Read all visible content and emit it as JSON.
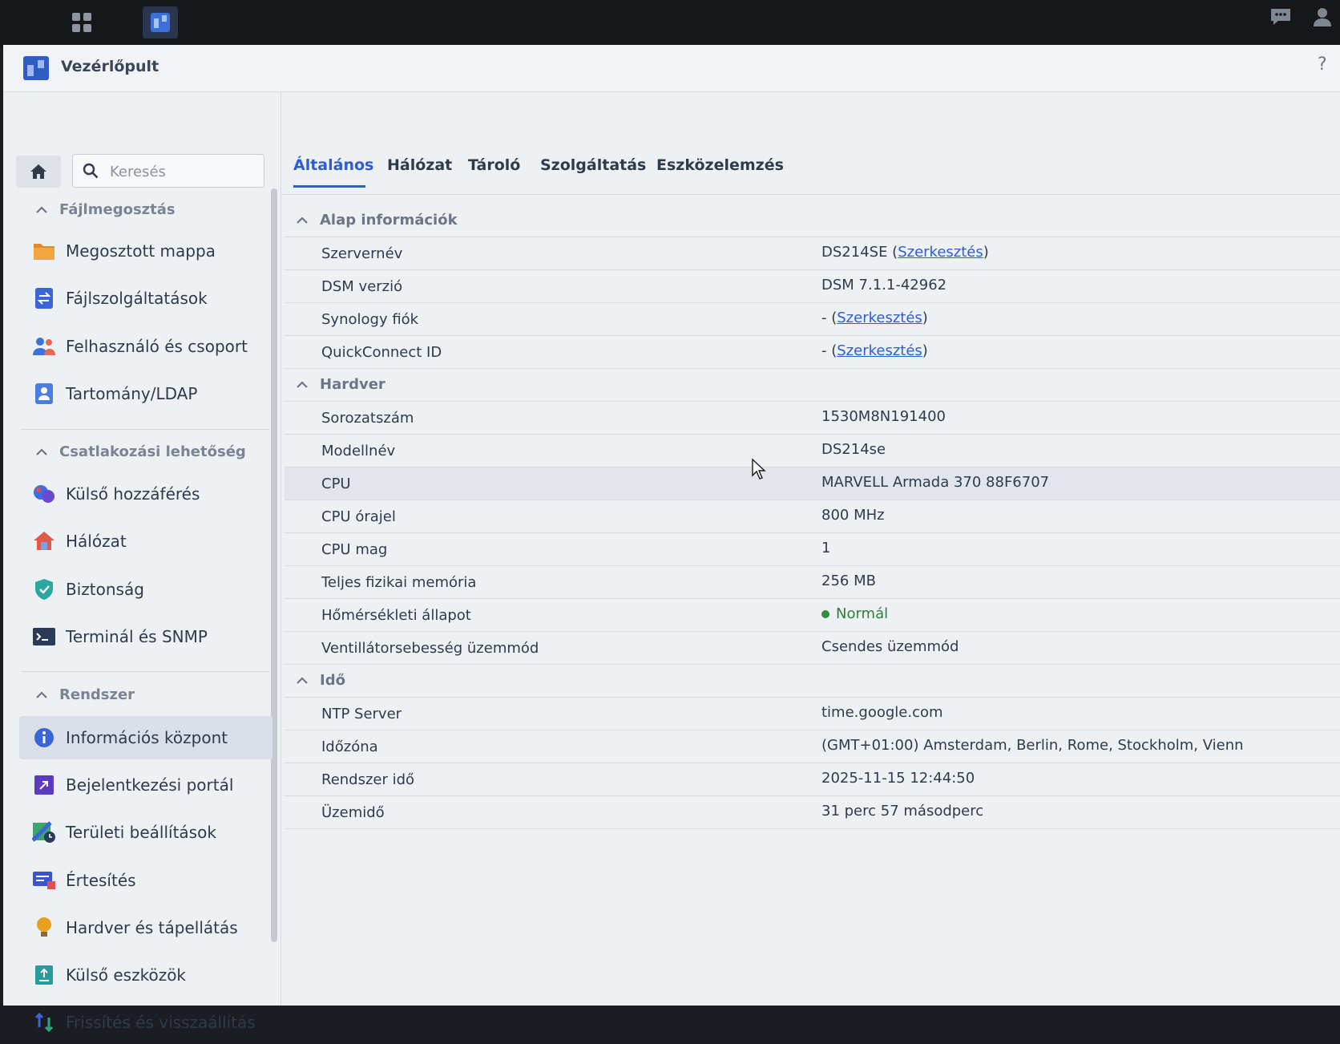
{
  "window": {
    "title": "Vezérlőpult",
    "help": "?"
  },
  "search": {
    "placeholder": "Keresés"
  },
  "sidebar": {
    "sections": [
      {
        "title": "Fájlmegosztás",
        "items": [
          {
            "label": "Megosztott mappa",
            "icon": "folder-icon"
          },
          {
            "label": "Fájlszolgáltatások",
            "icon": "file-services-icon"
          },
          {
            "label": "Felhasználó és csoport",
            "icon": "users-icon"
          },
          {
            "label": "Tartomány/LDAP",
            "icon": "ldap-icon"
          }
        ]
      },
      {
        "title": "Csatlakozási lehetőség",
        "items": [
          {
            "label": "Külső hozzáférés",
            "icon": "external-access-icon"
          },
          {
            "label": "Hálózat",
            "icon": "network-icon"
          },
          {
            "label": "Biztonság",
            "icon": "shield-icon"
          },
          {
            "label": "Terminál és SNMP",
            "icon": "terminal-icon"
          }
        ]
      },
      {
        "title": "Rendszer",
        "items": [
          {
            "label": "Információs központ",
            "icon": "info-icon",
            "active": true
          },
          {
            "label": "Bejelentkezési portál",
            "icon": "login-portal-icon"
          },
          {
            "label": "Területi beállítások",
            "icon": "regional-icon"
          },
          {
            "label": "Értesítés",
            "icon": "notification-icon"
          },
          {
            "label": "Hardver és tápellátás",
            "icon": "bulb-icon"
          },
          {
            "label": "Külső eszközök",
            "icon": "external-device-icon"
          },
          {
            "label": "Frissítés és visszaállítás",
            "icon": "update-icon"
          }
        ]
      }
    ]
  },
  "tabs": [
    "Általános",
    "Hálózat",
    "Tároló",
    "Szolgáltatás",
    "Eszközelemzés"
  ],
  "info": {
    "groups": [
      {
        "title": "Alap információk",
        "rows": [
          {
            "label": "Szervernév",
            "value": "DS214SE",
            "link": "Szerkesztés"
          },
          {
            "label": "DSM verzió",
            "value": "DSM 7.1.1-42962"
          },
          {
            "label": "Synology fiók",
            "value": "-",
            "link": "Szerkesztés"
          },
          {
            "label": "QuickConnect ID",
            "value": "-",
            "link": "Szerkesztés"
          }
        ]
      },
      {
        "title": "Hardver",
        "rows": [
          {
            "label": "Sorozatszám",
            "value": "1530M8N191400"
          },
          {
            "label": "Modellnév",
            "value": "DS214se"
          },
          {
            "label": "CPU",
            "value": "MARVELL Armada 370 88F6707"
          },
          {
            "label": "CPU órajel",
            "value": "800 MHz"
          },
          {
            "label": "CPU mag",
            "value": "1"
          },
          {
            "label": "Teljes fizikai memória",
            "value": "256 MB"
          },
          {
            "label": "Hőmérsékleti állapot",
            "value": "Normál",
            "status_color": "#2f8f3a"
          },
          {
            "label": "Ventillátorsebesség üzemmód",
            "value": "Csendes üzemmód"
          }
        ]
      },
      {
        "title": "Idő",
        "rows": [
          {
            "label": "NTP Server",
            "value": "time.google.com"
          },
          {
            "label": "Időzóna",
            "value": "(GMT+01:00) Amsterdam, Berlin, Rome, Stockholm, Vienn"
          },
          {
            "label": "Rendszer idő",
            "value": "2025-11-15 12:44:50"
          },
          {
            "label": "Üzemidő",
            "value": "31 perc 57 másodperc"
          }
        ]
      }
    ]
  },
  "colors": {
    "accent": "#2c5dd6",
    "ok": "#2f8f3a"
  }
}
